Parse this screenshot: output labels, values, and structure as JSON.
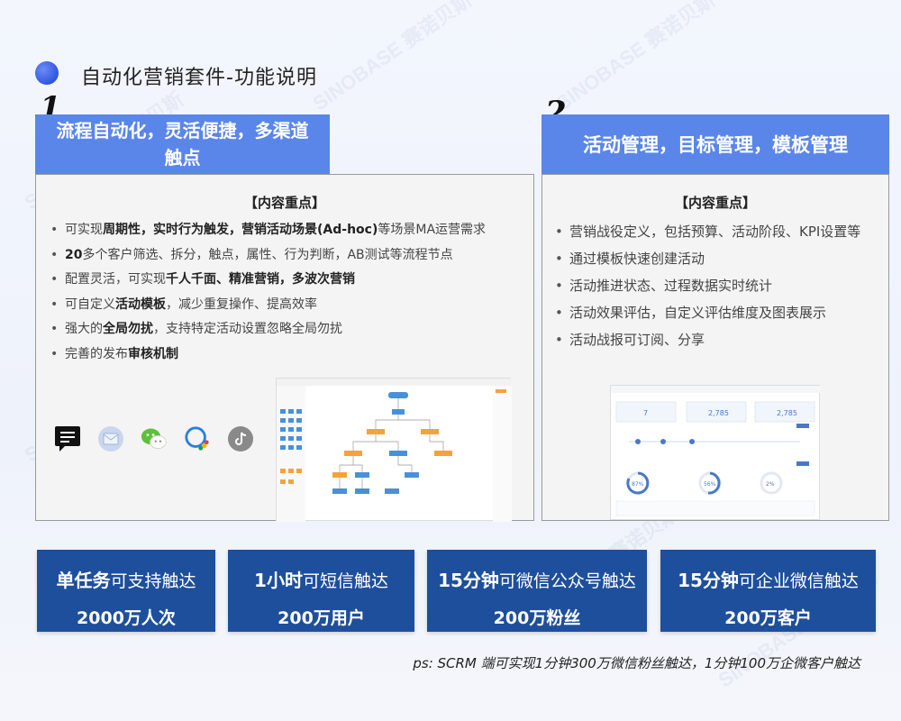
{
  "page": {
    "title": "自动化营销套件-功能说明",
    "watermark": "SINOBASE 赛诺贝斯"
  },
  "section1": {
    "number": "1",
    "title": "流程自动化，灵活便捷，多渠道触点",
    "heading": "【内容重点】",
    "bullets": [
      {
        "pre": "可实现",
        "bold": "周期性，实时行为触发，营销活动场景(Ad-hoc)",
        "post": "等场景MA运营需求"
      },
      {
        "pre": "",
        "bold": "20",
        "post": "多个客户筛选、拆分，触点，属性、行为判断，AB测试等流程节点"
      },
      {
        "pre": "配置灵活，可实现",
        "bold": "千人千面、精准营销，多波次营销",
        "post": ""
      },
      {
        "pre": "可自定义",
        "bold": "活动模板",
        "post": "，减少重复操作、提高效率"
      },
      {
        "pre": "强大的",
        "bold": "全局勿扰",
        "post": "，支持特定活动设置忽略全局勿扰"
      },
      {
        "pre": "完善的发布",
        "bold": "审核机制",
        "post": ""
      }
    ],
    "channel_icons": [
      {
        "name": "sms-icon",
        "color": "#111111"
      },
      {
        "name": "email-icon",
        "color": "#c9d6ee"
      },
      {
        "name": "wechat-icon",
        "color": "#5cc13c"
      },
      {
        "name": "wecom-icon",
        "color": "#2b7de0"
      },
      {
        "name": "tiktok-icon",
        "color": "#8a8a8a"
      }
    ]
  },
  "section2": {
    "number": "2",
    "title": "活动管理，目标管理，模板管理",
    "heading": "【内容重点】",
    "bullets": [
      "营销战役定义，包括预算、活动阶段、KPI设置等",
      "通过模板快速创建活动",
      "活动推进状态、过程数据实时统计",
      "活动效果评估，自定义评估维度及图表展示",
      "活动战报可订阅、分享"
    ],
    "mock_stats": [
      "7",
      "2,785",
      "2,785"
    ],
    "mock_rings": [
      "87%",
      "56%",
      "2%"
    ]
  },
  "stats": [
    {
      "top_bold": "单任务",
      "top_rest": "可支持触达",
      "bottom": "2000万人次"
    },
    {
      "top_bold": "1小时",
      "top_rest": "可短信触达",
      "bottom": "200万用户"
    },
    {
      "top_bold": "15分钟",
      "top_rest": "可微信公众号触达",
      "bottom": "200万粉丝"
    },
    {
      "top_bold": "15分钟",
      "top_rest": "可企业微信触达",
      "bottom": "200万客户"
    }
  ],
  "footnote": "ps: SCRM 端可实现1分钟300万微信粉丝触达，1分钟100万企微客户触达",
  "colors": {
    "accent": "#5a86ea",
    "stat_card": "#1e4f9c",
    "flow_orange": "#f2a43a",
    "flow_blue": "#4a90d9"
  }
}
